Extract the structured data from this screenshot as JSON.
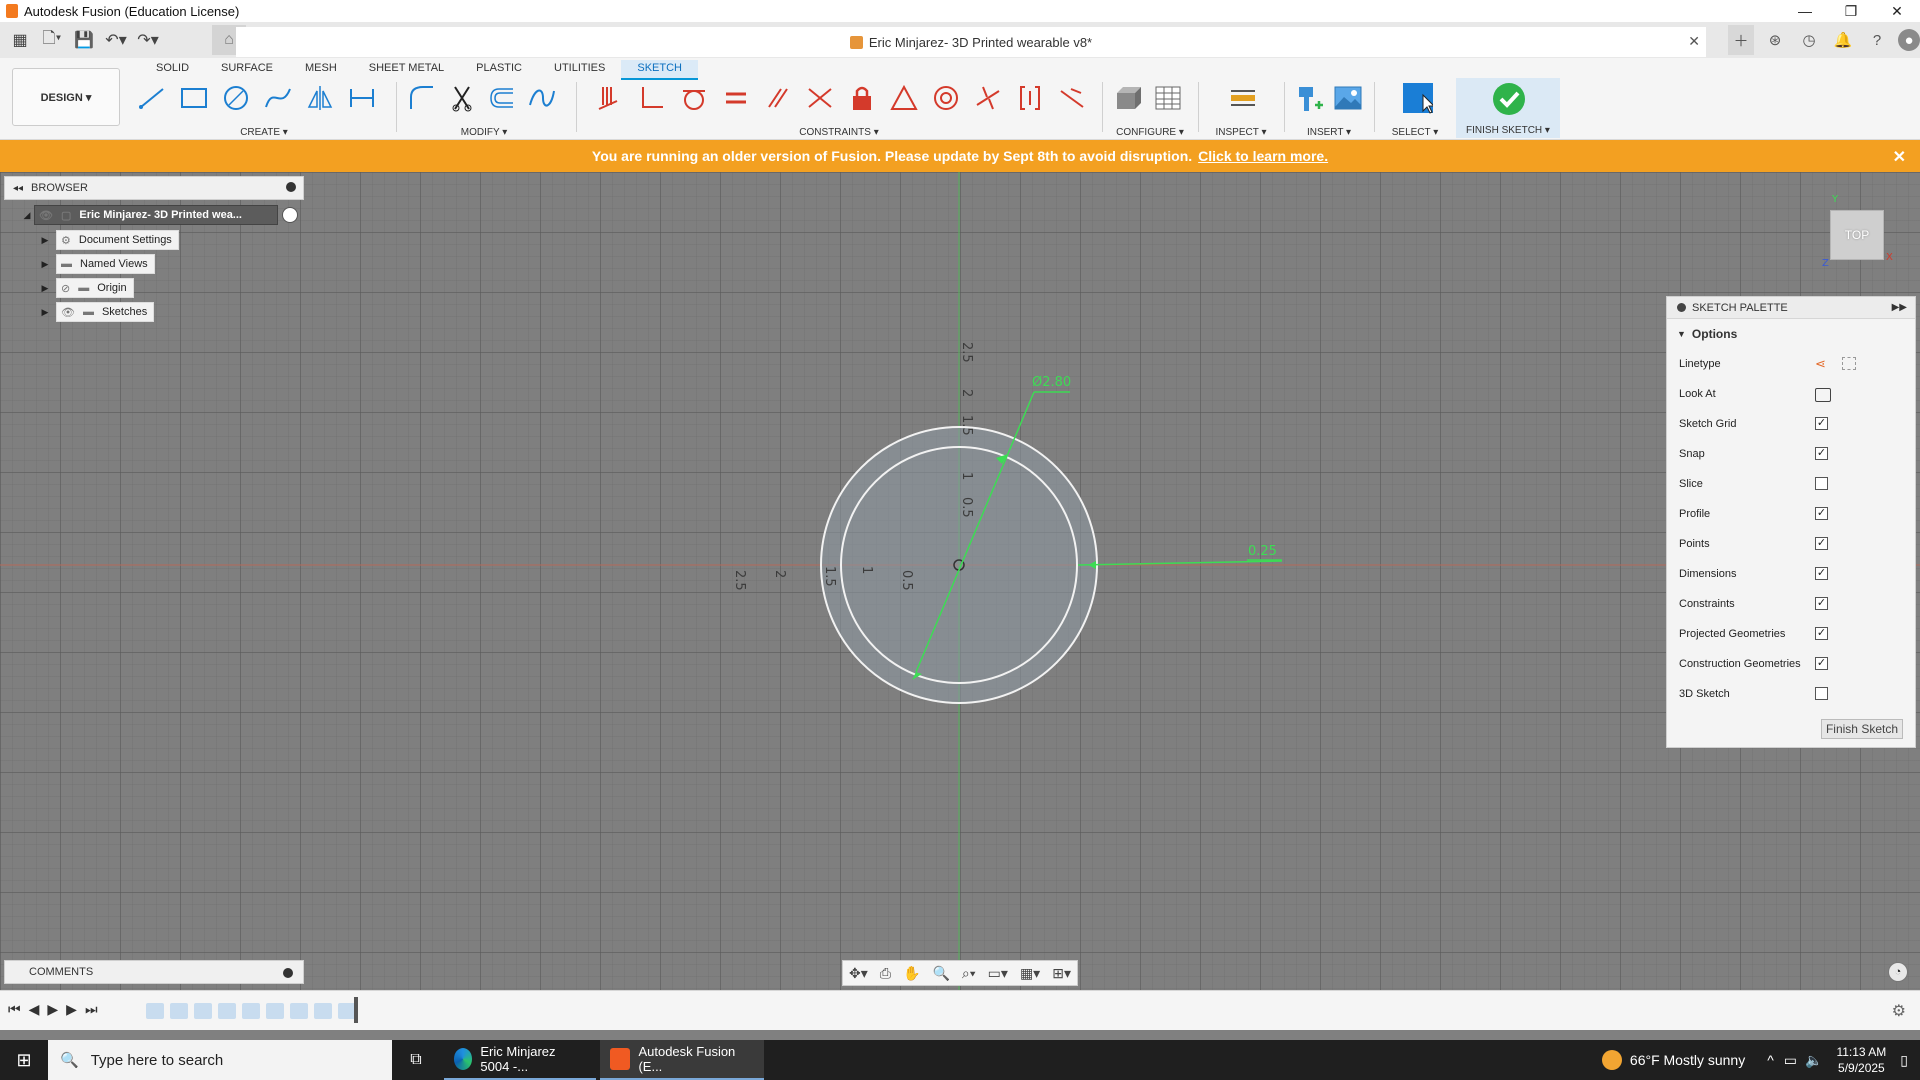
{
  "window": {
    "title": "Autodesk Fusion (Education License)",
    "controls": [
      "—",
      "❐",
      "✕"
    ]
  },
  "document": {
    "title": "Eric Minjarez- 3D Printed wearable v8*",
    "close": "✕"
  },
  "ribbon": {
    "tabs": [
      "SOLID",
      "SURFACE",
      "MESH",
      "SHEET METAL",
      "PLASTIC",
      "UTILITIES",
      "SKETCH"
    ],
    "active_tab": "SKETCH",
    "workspace": "DESIGN ▾",
    "groups": {
      "create": "CREATE ▾",
      "modify": "MODIFY ▾",
      "constraints": "CONSTRAINTS ▾",
      "configure": "CONFIGURE ▾",
      "inspect": "INSPECT ▾",
      "insert": "INSERT ▾",
      "select": "SELECT ▾",
      "finish": "FINISH SKETCH ▾"
    },
    "accent": "#0696d7",
    "finish_color": "#2fb34a"
  },
  "banner": {
    "message": "You are running an older version of Fusion. Please update by Sept 8th to avoid disruption.",
    "link": "Click to learn more.",
    "close": "✕",
    "color": "#f3a021"
  },
  "browser": {
    "title": "BROWSER",
    "root": "Eric Minjarez- 3D Printed wea...",
    "items": [
      {
        "label": "Document Settings",
        "icon": "gear-icon"
      },
      {
        "label": "Named Views",
        "icon": "folder-icon"
      },
      {
        "label": "Origin",
        "icon": "folder-icon"
      },
      {
        "label": "Sketches",
        "icon": "folder-icon"
      }
    ]
  },
  "sketch": {
    "diameter_label": "Ø2.80",
    "offset_label": "0.25",
    "axis_labels_vertical": [
      "2.5",
      "2",
      "1.5",
      "1",
      "0.5"
    ],
    "axis_labels_horizontal": [
      "2.5",
      "2",
      "1.5",
      "1",
      "0.5"
    ],
    "dimension_color": "#3ddc54"
  },
  "viewcube": {
    "face": "TOP",
    "axes": [
      "Y",
      "Z",
      "X"
    ]
  },
  "palette": {
    "title": "SKETCH PALETTE",
    "section": "Options",
    "rows": [
      {
        "label": "Linetype",
        "type": "icons"
      },
      {
        "label": "Look At",
        "type": "icon"
      },
      {
        "label": "Sketch Grid",
        "checked": true
      },
      {
        "label": "Snap",
        "checked": true
      },
      {
        "label": "Slice",
        "checked": false
      },
      {
        "label": "Profile",
        "checked": true
      },
      {
        "label": "Points",
        "checked": true
      },
      {
        "label": "Dimensions",
        "checked": true
      },
      {
        "label": "Constraints",
        "checked": true
      },
      {
        "label": "Projected Geometries",
        "checked": true
      },
      {
        "label": "Construction Geometries",
        "checked": true
      },
      {
        "label": "3D Sketch",
        "checked": false
      }
    ],
    "finish_button": "Finish Sketch"
  },
  "comments": {
    "title": "COMMENTS"
  },
  "taskbar": {
    "search_placeholder": "Type here to search",
    "apps": [
      {
        "label": "Eric Minjarez 5004 -..."
      },
      {
        "label": "Autodesk Fusion (E..."
      }
    ],
    "weather": "66°F  Mostly sunny",
    "time": "11:13 AM",
    "date": "5/9/2025"
  }
}
